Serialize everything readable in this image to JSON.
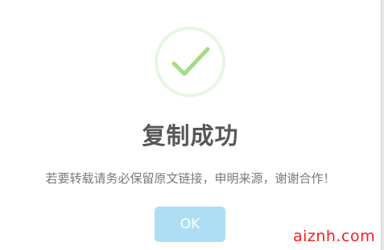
{
  "dialog": {
    "icon": "success-checkmark-icon",
    "title": "复制成功",
    "message": "若要转载请务必保留原文链接，申明来源，谢谢合作！",
    "ok_label": "OK"
  },
  "watermark": {
    "text": "aiznh.com"
  },
  "colors": {
    "check_color": "#a5dc86",
    "ring_color": "#eef8e8",
    "button_bg": "#aedef4",
    "title_color": "#575757",
    "message_color": "#797979",
    "watermark_color": "#ff1a1a"
  }
}
